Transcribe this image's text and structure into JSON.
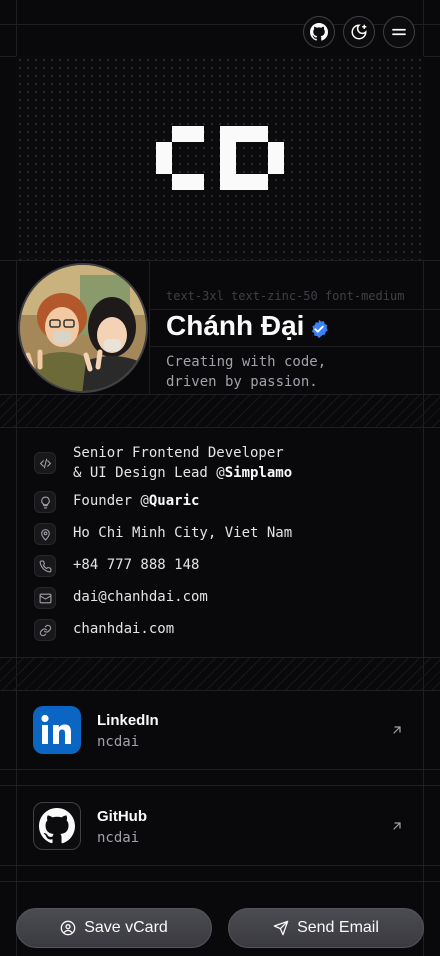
{
  "header": {
    "github_icon": "github-icon",
    "theme_icon": "theme-toggle-icon",
    "menu_icon": "menu-icon"
  },
  "profile": {
    "class_hint": "text-3xl text-zinc-50 font-medium",
    "name": "Chánh Đại",
    "tagline_line1": "Creating with code,",
    "tagline_line2": "driven by passion."
  },
  "details": {
    "role_line1": "Senior Frontend Developer",
    "role_line2_prefix": "& UI Design Lead @",
    "role_company": "Simplamo",
    "founder_prefix": "Founder @",
    "founder_company": "Quaric",
    "location": "Ho Chi Minh City, Viet Nam",
    "phone": "+84 777 888 148",
    "email": "dai@chanhdai.com",
    "website": "chanhdai.com"
  },
  "social": [
    {
      "name": "LinkedIn",
      "handle": "ncdai",
      "icon": "linkedin-icon"
    },
    {
      "name": "GitHub",
      "handle": "ncdai",
      "icon": "github-icon"
    }
  ],
  "actions": {
    "save_vcard": "Save vCard",
    "send_email": "Send Email"
  },
  "colors": {
    "background": "#09090b",
    "linkedin": "#0a66c2",
    "verified": "#3b82f6"
  }
}
